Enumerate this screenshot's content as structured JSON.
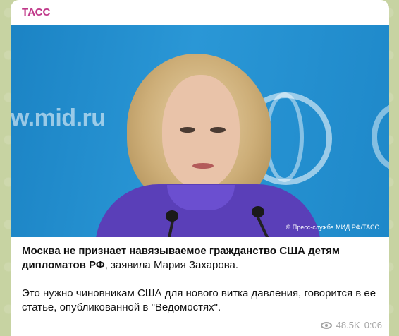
{
  "post": {
    "channel_name": "ТАСС",
    "photo_url_text": "w.mid.ru",
    "photo_credit": "© Пресс-служба МИД РФ/ТАСС",
    "headline_bold": "Москва не признает навязываемое гражданство США детям дипломатов РФ",
    "headline_rest": ", заявила Мария Захарова.",
    "body": "Это нужно чиновникам США для нового витка давления, говорится в ее статье, опубликованной в \"Ведомостях\".",
    "views": "48.5K",
    "time": "0:06",
    "views_icon": "eye-icon"
  },
  "colors": {
    "channel": "#c0398a",
    "background": "#c7d3a2",
    "bubble": "#ffffff",
    "meta": "#a3a3a3"
  }
}
